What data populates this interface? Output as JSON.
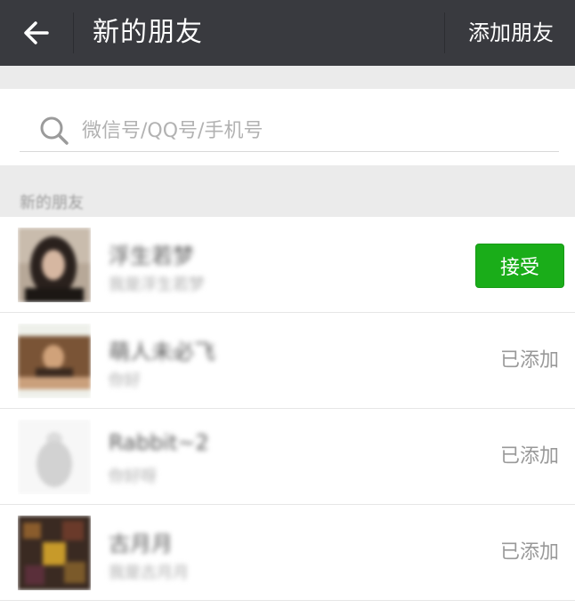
{
  "topbar": {
    "title": "新的朋友",
    "action": "添加朋友"
  },
  "search": {
    "placeholder": "微信号/QQ号/手机号"
  },
  "section": {
    "label": "新的朋友"
  },
  "friends": [
    {
      "name": "浮生若梦",
      "subtitle": "我是浮生若梦",
      "action": "接受",
      "status": "pending"
    },
    {
      "name": "萌人未必飞",
      "subtitle": "你好",
      "action": "已添加",
      "status": "added"
    },
    {
      "name": "Rabbit~2",
      "subtitle": "你好呀",
      "action": "已添加",
      "status": "added"
    },
    {
      "name": "古月月",
      "subtitle": "我是古月月",
      "action": "已添加",
      "status": "added"
    }
  ],
  "colors": {
    "topbar": "#393a3f",
    "accept": "#1aad19",
    "background": "#ebebeb"
  }
}
